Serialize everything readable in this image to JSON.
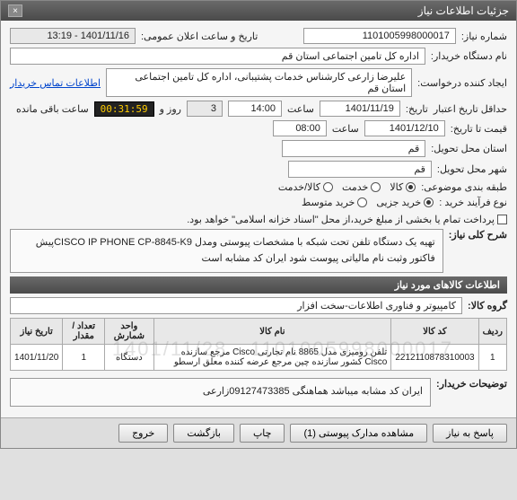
{
  "window": {
    "title": "جزئیات اطلاعات نیاز"
  },
  "header": {
    "req_no_label": "شماره نیاز:",
    "req_no": "1101005998000017",
    "announce_label": "تاریخ و ساعت اعلان عمومی:",
    "announce_value": "1401/11/16 - 13:19",
    "buyer_org_label": "نام دستگاه خریدار:",
    "buyer_org": "اداره کل تامین اجتماعی استان قم",
    "creator_label": "ایجاد کننده درخواست:",
    "creator": "علیرضا زارعی کارشناس خدمات پشتیبانی، اداره کل تامین اجتماعی استان قم",
    "contact_link": "اطلاعات تماس خریدار",
    "deadline_send_label": "حداقل تاریخ اعتبار",
    "deadline_send_label2": "تاریخ:",
    "deadline_send_date": "1401/11/19",
    "deadline_send_time_label": "ساعت",
    "deadline_send_time": "14:00",
    "days": "3",
    "days_label": "روز و",
    "timer": "00:31:59",
    "remain_label": "ساعت باقی مانده",
    "price_until_label": "قیمت تا تاریخ:",
    "price_until_date": "1401/12/10",
    "price_until_time_label": "ساعت",
    "price_until_time": "08:00",
    "city_deliver_label": "استان محل تحویل:",
    "city_deliver": "قم",
    "city_deliver2_label": "شهر محل تحویل:",
    "city_deliver2": "قم",
    "category_label": "طبقه بندی موضوعی:",
    "cat_goods": "کالا",
    "cat_service": "خدمت",
    "cat_goods_service": "کالا/خدمت",
    "buy_process_label": "نوع فرآیند خرید :",
    "buy_low": "خرید جزیی",
    "buy_mid": "خرید متوسط",
    "pay_note": "پرداخت تمام یا بخشی از مبلغ خرید،از محل \"اسناد خزانه اسلامی\" خواهد بود.",
    "general_desc_label": "شرح کلی نیاز:",
    "general_desc": "تهیه یک دستگاه تلفن تحت شبکه با مشخصات پیوستی ومدل CISCO IP PHONE CP-8845-K9پیش فاکتور وثبت نام مالیاتی پیوست شود ایران کد مشابه است"
  },
  "section_items_title": "اطلاعات کالاهای مورد نیاز",
  "group_label": "گروه کالا:",
  "group_value": "کامپیوتر و فناوری اطلاعات-سخت افزار",
  "table": {
    "headers": [
      "ردیف",
      "کد کالا",
      "نام کالا",
      "واحد شمارش",
      "تعداد / مقدار",
      "تاریخ نیاز"
    ],
    "rows": [
      {
        "idx": "1",
        "code": "2212110878310003",
        "name": "تلفن رومیزی مدل 8865 نام تجارتی Cisco مرجع سازنده Cisco کشور سازنده چین مرجع عرضه کننده معلق ارسطو",
        "unit": "دستگاه",
        "qty": "1",
        "date": "1401/11/20"
      }
    ]
  },
  "watermark": "1101005998000017  -  1401/11/28",
  "buyer_note_label": "توضیحات خریدار:",
  "buyer_note": "ایران کد مشابه میباشد هماهنگی 09127473385زارعی",
  "footer": {
    "reply": "پاسخ به نیاز",
    "attachments": "مشاهده مدارک پیوستی (1)",
    "print": "چاپ",
    "back": "بازگشت",
    "close": "خروج"
  }
}
